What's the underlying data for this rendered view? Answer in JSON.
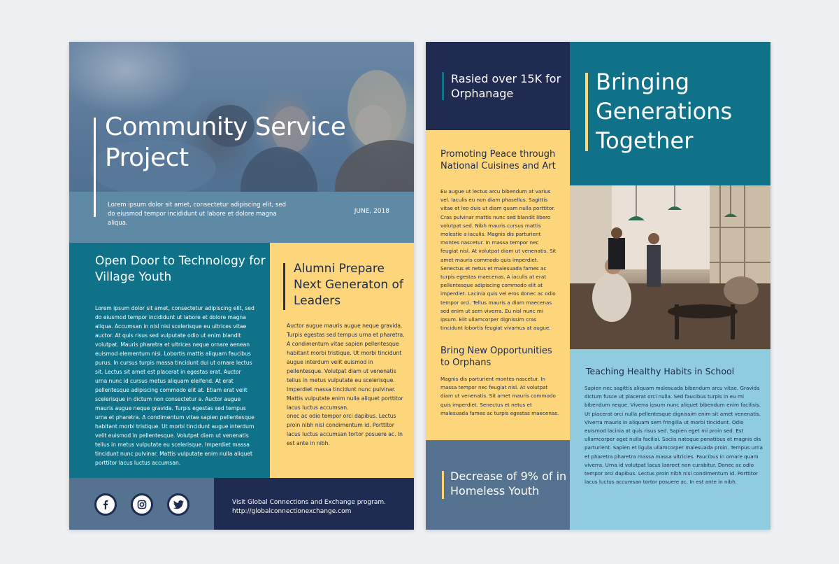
{
  "left_page": {
    "hero": {
      "title": "Community Service Project",
      "subtitle": "Lorem ipsum dolor sit amet, consectetur adipiscing elit, sed do eiusmod tempor incididunt ut labore et dolore magna aliqua.",
      "date": "JUNE, 2018"
    },
    "article_open_door": {
      "heading": "Open Door to Technology for Village Youth",
      "body": "Lorem ipsum dolor sit amet, consectetur adipiscing elit, sed do eiusmod tempor incididunt ut labore et dolore magna aliqua. Accumsan in nisl nisi scelerisque eu ultrices vitae auctor. At quis risus sed vulputate odio ut enim blandit volutpat. Mauris pharetra et ultrices neque ornare aenean euismod elementum nisi. Lobortis mattis aliquam faucibus purus. In cursus turpis massa tincidunt dui ut ornare lectus sit. Lectus sit amet est placerat in egestas erat. Auctor urna nunc id cursus metus aliquam eleifend. At erat pellentesque adipiscing commodo elit at. Etiam erat velit scelerisque in dictum non consectetur a. Auctor augue mauris augue neque gravida. Turpis egestas sed tempus urna et pharetra. A condimentum vitae sapien pellentesque habitant morbi tristique. Ut morbi tincidunt augue interdum velit euismod in pellentesque. Volutpat diam ut venenatis tellus in metus vulputate eu scelerisque. Imperdiet massa tincidunt nunc pulvinar. Mattis vulputate enim nulla aliquet porttitor lacus luctus accumsan."
    },
    "article_alumni": {
      "heading": "Alumni Prepare Next Generaton of Leaders",
      "body": "Auctor augue mauris augue neque gravida. Turpis egestas sed tempus urna et pharetra. A condimentum vitae sapien pellentesque habitant morbi tristique. Ut morbi tincidunt augue interdum velit euismod in pellentesque. Volutpat diam ut venenatis tellus in metus vulputate eu scelerisque. Imperdiet massa tincidunt nunc pulvinar. Mattis vulputate enim nulla aliquet porttitor lacus luctus accumsan.",
      "body2": "onec ac odio tempor orci dapibus. Lectus proin nibh nisl condimentum id. Porttitor lacus luctus accumsan tortor posuere ac. In est ante in nibh."
    },
    "footer": {
      "social_icons": [
        "facebook-icon",
        "instagram-icon",
        "twitter-icon"
      ],
      "line1": "Visit Global Connections and Exchange program.",
      "line2": "http://globalconnectionexchange.com"
    }
  },
  "right_page": {
    "raised": "Rasied over 15K for Orphanage",
    "headline": "Bringing Generations Together",
    "article_peace": {
      "heading": "Promoting Peace through National Cuisines and Art",
      "body": "Eu augue ut lectus arcu bibendum at varius vel. Iaculis eu non diam phasellus. Sagittis vitae et leo duis ut diam quam nulla porttitor. Cras pulvinar mattis nunc sed blandit libero volutpat sed. Nibh mauris cursus mattis molestie a iaculis. Magnis dis parturient montes nascetur. In massa tempor nec feugiat nisl. At volutpat diam ut venenatis. Sit amet mauris commodo quis imperdiet. Senectus et netus et malesuada fames ac turpis egestas maecenas. A iaculis at erat pellentesque adipiscing commodo elit at imperdiet. Lacinia quis vel eros donec ac odio tempor orci. Tellus mauris a diam maecenas sed enim ut sem viverra. Eu nisl nunc mi ipsum. Elit ullamcorper dignissim cras tincidunt lobortis feugiat vivamus at augue."
    },
    "article_opportunities": {
      "heading": "Bring New Opportunities to Orphans",
      "body": "Magnis dis parturient montes nascetur. In massa tempor nec feugiat nisl. At volutpat diam ut venenatis. Sit amet mauris commodo quis imperdiet. Senectus et netus et malesuada fames ac turpis egestas maecenas."
    },
    "decrease": "Decrease of 9% of in Homeless Youth",
    "article_habits": {
      "heading": "Teaching Healthy Habits in School",
      "body": "Sapien nec sagittis aliquam malesuada bibendum arcu vitae. Gravida dictum fusce ut placerat orci nulla. Sed faucibus turpis in eu mi bibendum neque. Viverra ipsum nunc aliquet bibendum enim facilisis. Ut placerat orci nulla pellentesque dignissim enim sit amet venenatis. Viverra mauris in aliquam sem fringilla ut morbi tincidunt. Odio euismod lacinia at quis risus sed. Sapien eget mi proin sed. Est ullamcorper eget nulla facilisi. Sociis natoque penatibus et magnis dis parturient. Sapien et ligula ullamcorper malesuada proin. Tempus urna et pharetra pharetra massa massa ultricies. Faucibus in ornare quam viverra. Urna id volutpat lacus laoreet non curabitur. Donec ac odio tempor orci dapibus. Lectus proin nibh nisl condimentum id. Porttitor lacus luctus accumsan tortor posuere ac. In est ante in nibh."
    }
  },
  "colors": {
    "teal": "#0f7289",
    "navy": "#1f2b50",
    "yellow": "#fdd57b",
    "slate_blue": "#557390",
    "light_blue": "#8fccdf",
    "background": "#eef1f4"
  }
}
